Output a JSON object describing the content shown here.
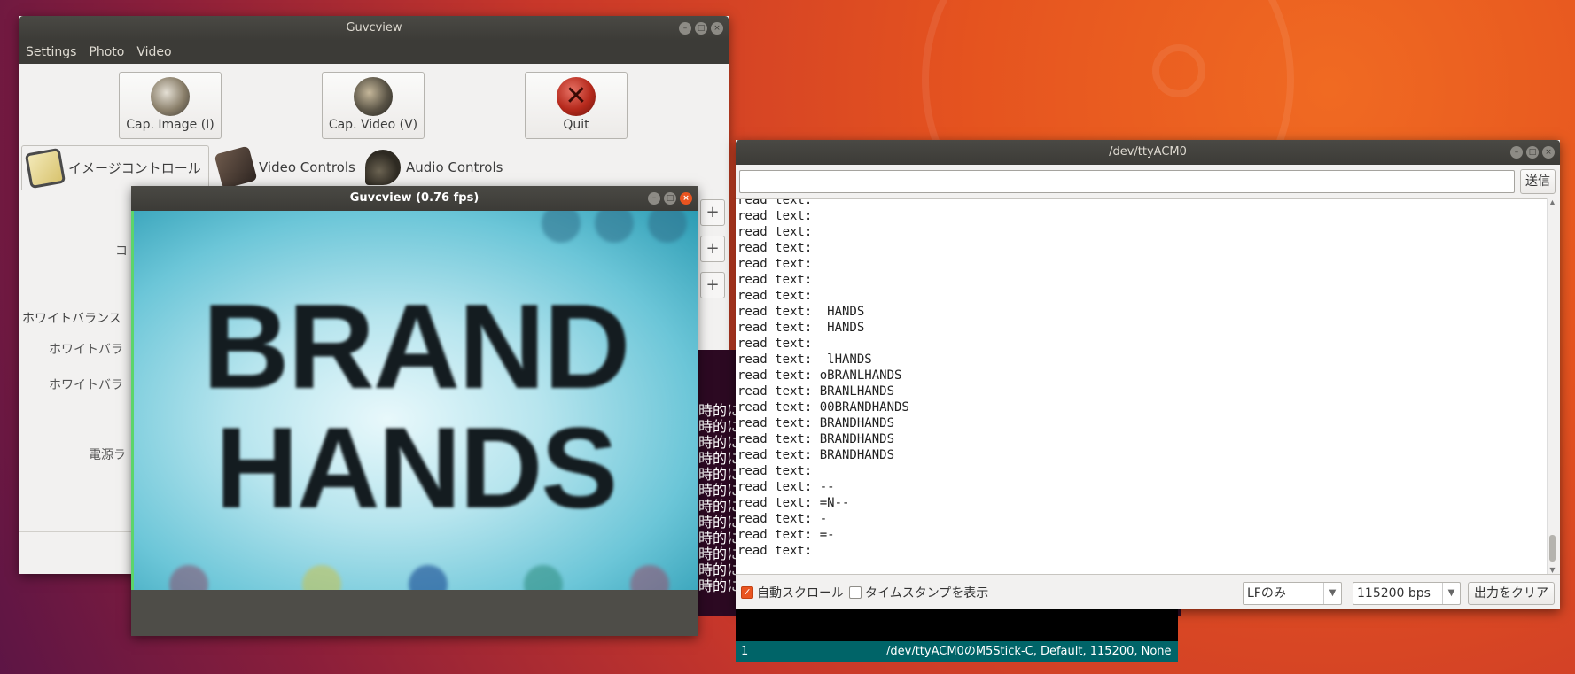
{
  "desktop": {
    "accent": "#e95420"
  },
  "guvcview_main": {
    "title": "Guvcview",
    "menu": [
      "Settings",
      "Photo",
      "Video"
    ],
    "buttons": {
      "cap_image": "Cap. Image (I)",
      "cap_video": "Cap. Video (V)",
      "quit": "Quit"
    },
    "tabs": [
      "イメージコントロール",
      "Video Controls",
      "Audio Controls"
    ],
    "control_labels": [
      "コ",
      "ホワイトバランス",
      "ホワイトバラ",
      "ホワイトバラ",
      "電源ラ"
    ]
  },
  "guvcview_preview": {
    "title": "Guvcview  (0.76 fps)",
    "image_text_line1": "BRAND",
    "image_text_line2": "HANDS"
  },
  "terminal": {
    "lines": [
      "時的に",
      "時的に",
      "時的に",
      "時的に",
      "時的に",
      "時的に",
      "時的に",
      "時的に",
      "時的に",
      "時的に",
      "時的に",
      "時的に"
    ]
  },
  "serial_monitor": {
    "title": "/dev/ttyACM0",
    "send_label": "送信",
    "input_value": "",
    "output_lines": [
      "read text:",
      "read text:",
      "read text:",
      "read text:",
      "read text:",
      "read text:",
      "read text:",
      "read text:  HANDS",
      "read text:  HANDS",
      "read text:",
      "read text:  lHANDS",
      "read text: oBRANLHANDS",
      "read text: BRANLHANDS",
      "read text: 00BRANDHANDS",
      "read text: BRANDHANDS",
      "read text: BRANDHANDS",
      "read text: BRANDHANDS",
      "read text:",
      "read text: --",
      "read text: =N--",
      "read text: -",
      "read text: =-",
      "read text:"
    ],
    "autoscroll_label": "自動スクロール",
    "autoscroll_checked": true,
    "timestamp_label": "タイムスタンプを表示",
    "timestamp_checked": false,
    "line_ending": "LFのみ",
    "baud_rate": "115200 bps",
    "clear_label": "出力をクリア"
  },
  "arduino_status": {
    "line": "1",
    "board": "/dev/ttyACM0のM5Stick-C, Default, 115200, None"
  }
}
